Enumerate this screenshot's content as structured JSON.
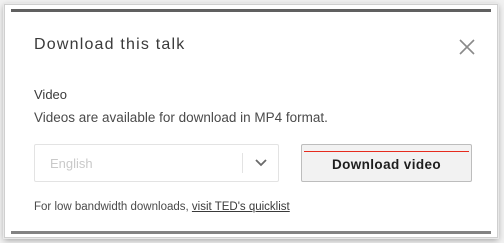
{
  "modal": {
    "title": "Download this talk",
    "close_icon": "close-icon",
    "video_section": {
      "label": "Video",
      "description": "Videos are available for download in MP4 format."
    },
    "language_select": {
      "selected": "English",
      "icon": "chevron-down-icon"
    },
    "download_button": {
      "label": "Download video"
    },
    "footer": {
      "text": "For low bandwidth downloads, ",
      "link": "visit TED's quicklist"
    }
  },
  "colors": {
    "accent": "#e62b1e",
    "text": "#2b2b2b",
    "muted": "#c9c9c9"
  }
}
